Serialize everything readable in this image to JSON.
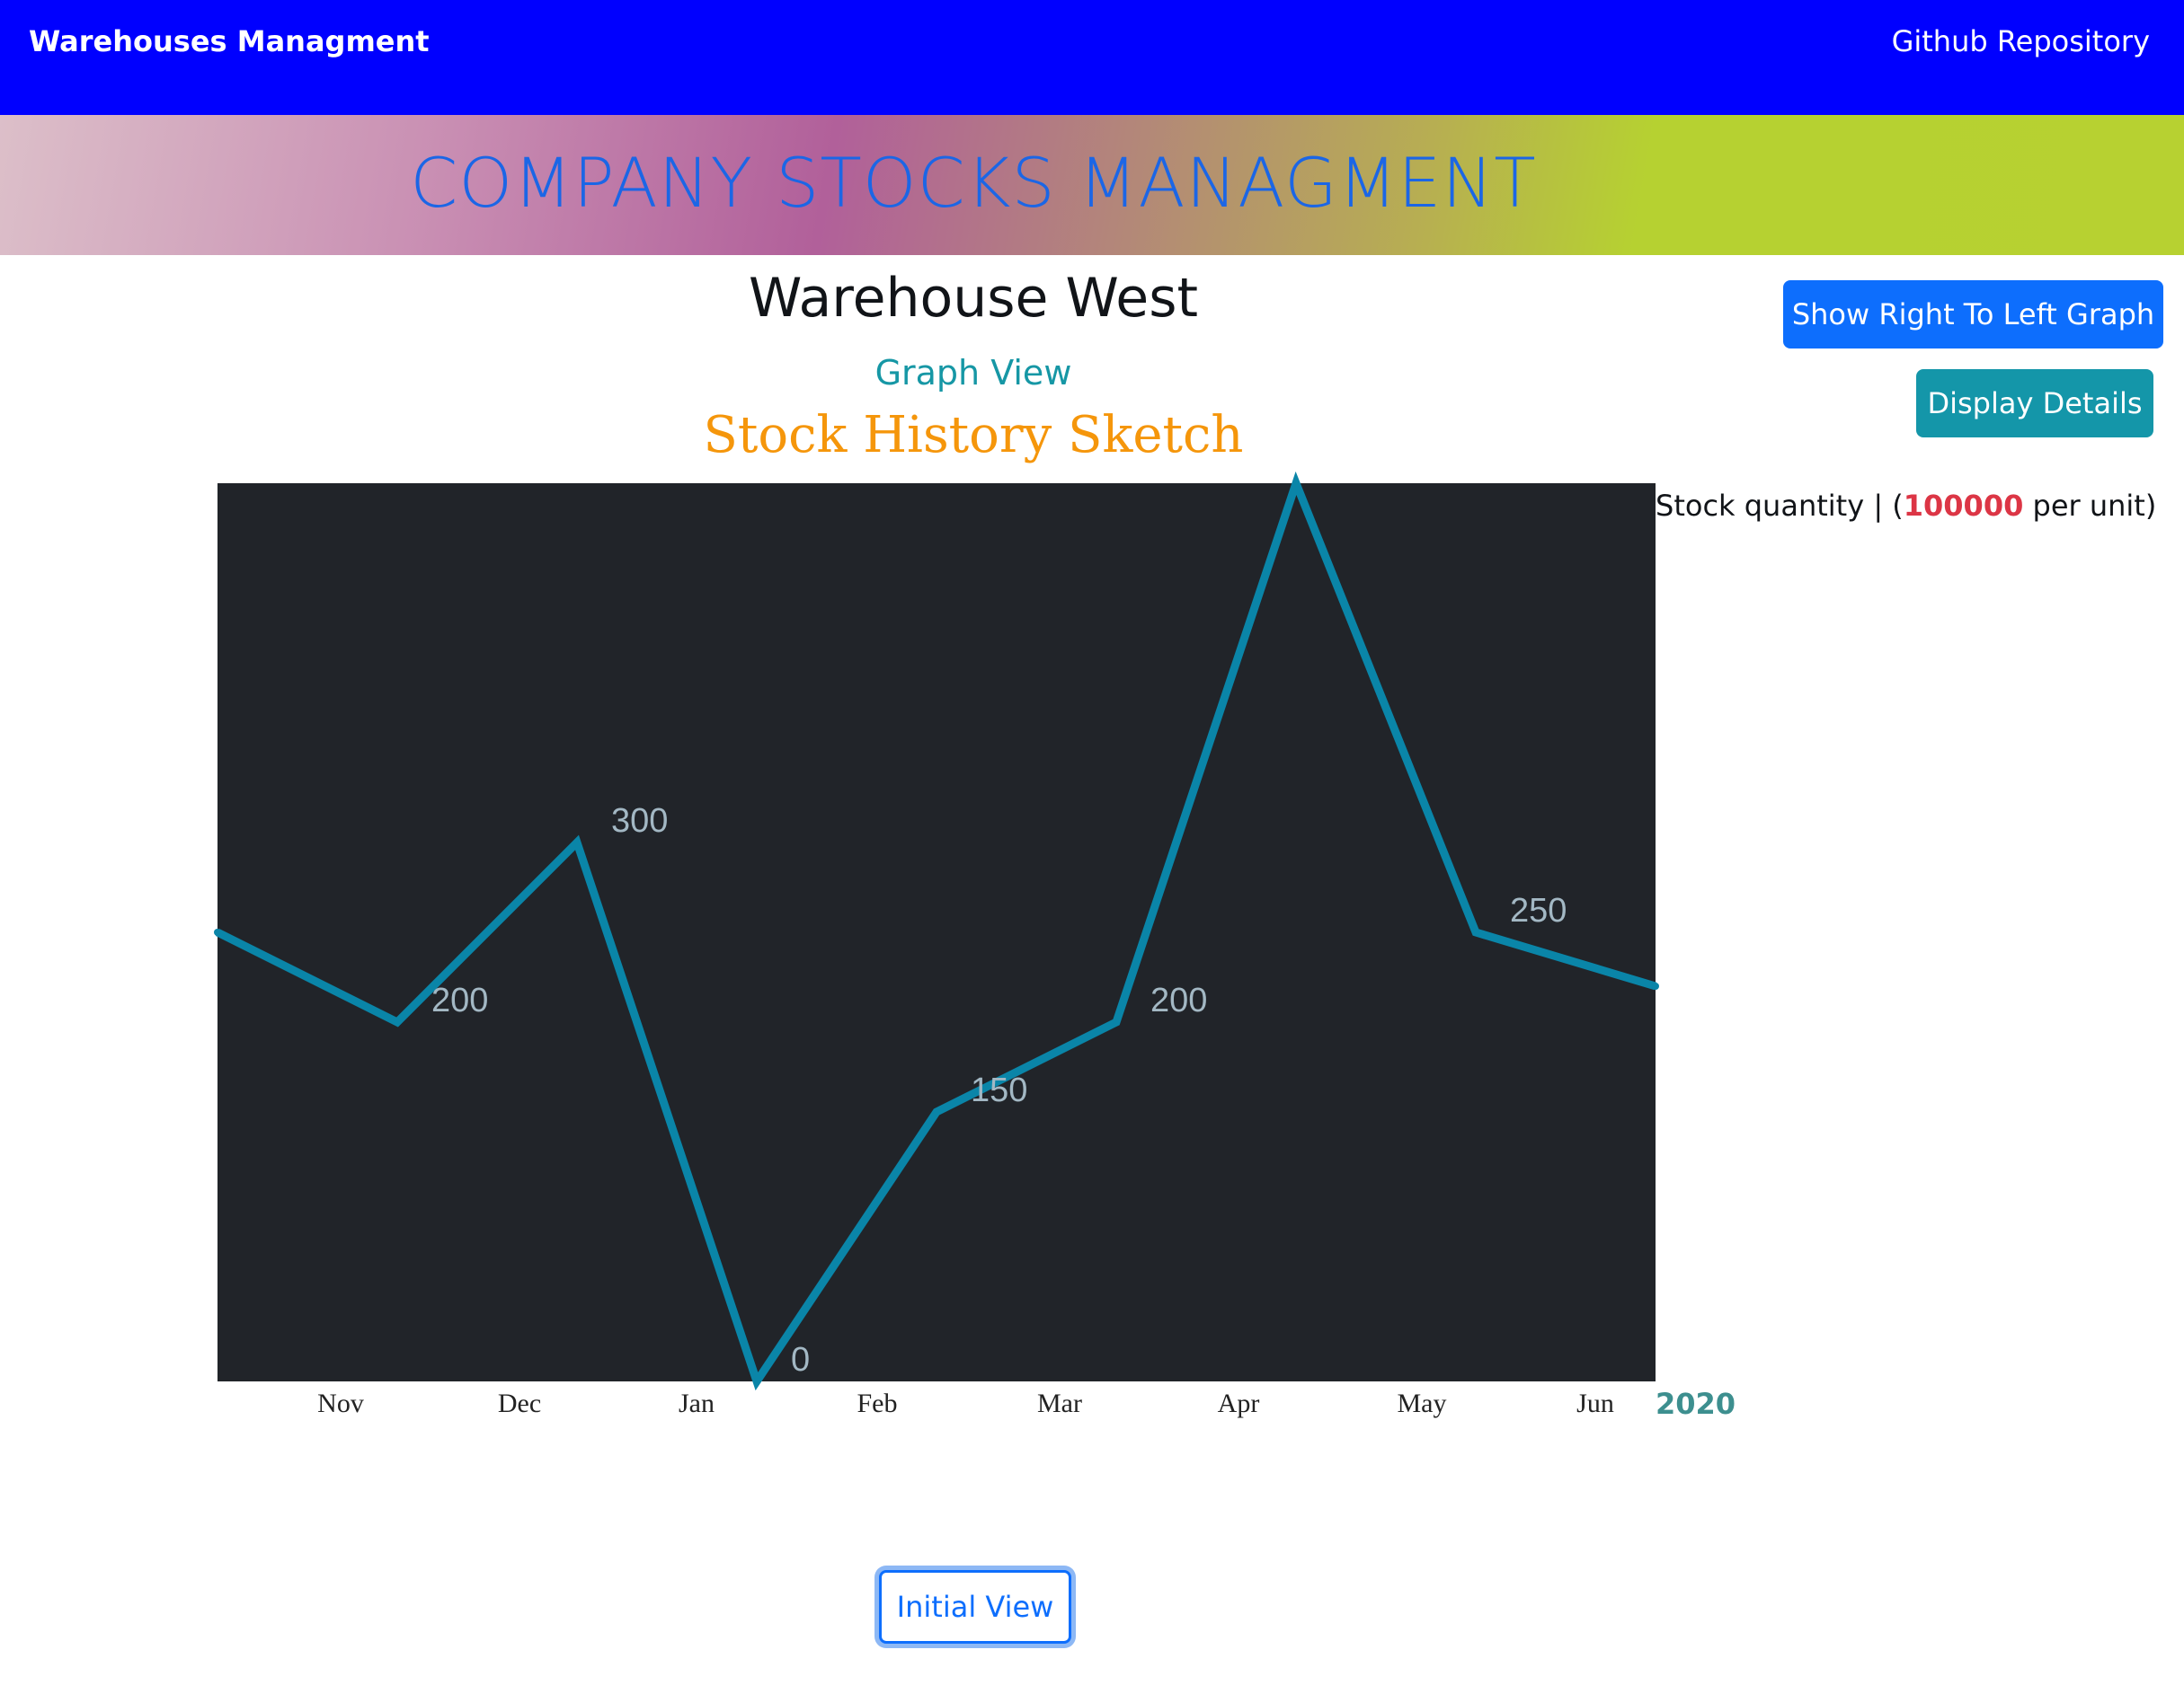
{
  "navbar": {
    "brand": "Warehouses Managment",
    "github_link": "Github Repository"
  },
  "banner": {
    "title": "COMPANY STOCKS MANAGMENT"
  },
  "warehouse": {
    "title": "Warehouse West",
    "view_label": "Graph View",
    "sketch_title": "Stock History Sketch"
  },
  "buttons": {
    "rtl_graph": "Show Right To Left Graph",
    "display_details": "Display Details",
    "initial_view": "Initial View"
  },
  "legend": {
    "prefix": "Stock quantity | (",
    "unit_value": "100000",
    "suffix": " per unit)",
    "year": "2020"
  },
  "colors": {
    "navbar": "#0000ff",
    "plot_background": "#212429",
    "line": "#0a85a8",
    "data_label": "#a3b8c4"
  },
  "chart_data": {
    "type": "line",
    "x_ticks": [
      "Nov",
      "Dec",
      "Jan",
      "Feb",
      "Mar",
      "Apr",
      "May",
      "Jun"
    ],
    "series": [
      {
        "values": [
          250,
          200,
          300,
          0,
          150,
          200,
          500,
          250,
          220
        ],
        "labels": [
          "",
          "200",
          "300",
          "0",
          "150",
          "200",
          "",
          "250",
          ""
        ]
      }
    ],
    "ylim": [
      0,
      500
    ],
    "grid": false
  }
}
